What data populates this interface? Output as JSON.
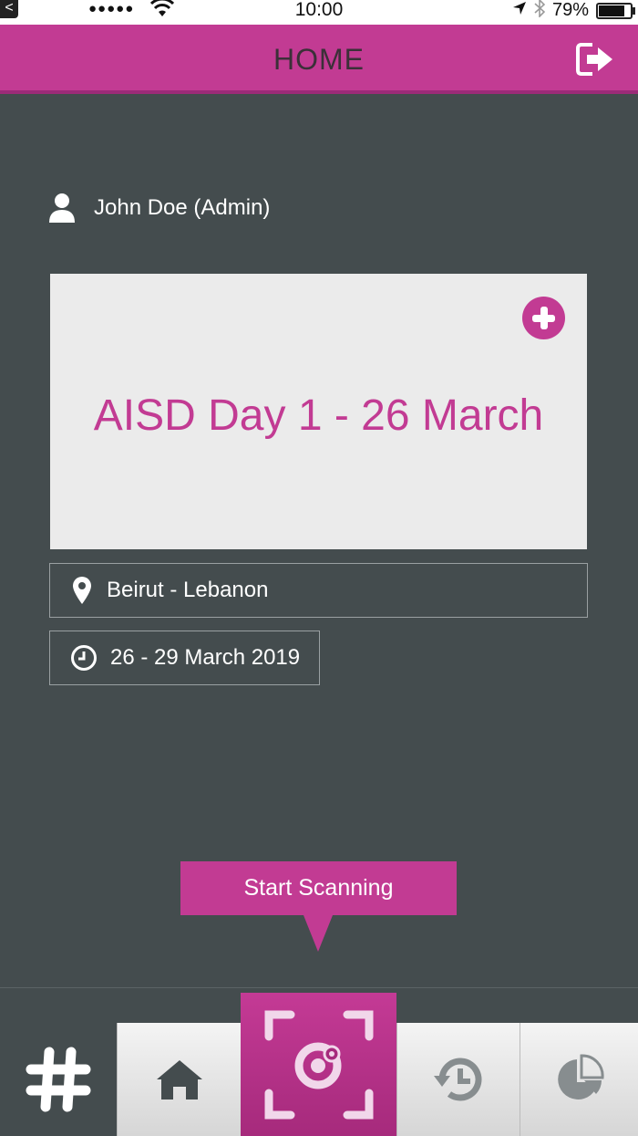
{
  "status_bar": {
    "back_glyph": "<",
    "signal": "●●●●●",
    "time": "10:00",
    "battery": "79%"
  },
  "header": {
    "title": "HOME",
    "logout_icon": "logout-icon"
  },
  "user": {
    "name": "John Doe (Admin)",
    "icon": "user-icon"
  },
  "event": {
    "title": "AISD Day 1 - 26 March",
    "add_icon": "plus-circle-icon"
  },
  "location": {
    "text": "Beirut - Lebanon",
    "icon": "map-pin-icon"
  },
  "date": {
    "text": "26 - 29 March 2019",
    "icon": "clock-icon"
  },
  "tooltip": {
    "text": "Start Scanning"
  },
  "tabs": [
    {
      "name": "tab-hashtag",
      "icon": "hashtag-icon"
    },
    {
      "name": "tab-home",
      "icon": "home-icon"
    },
    {
      "name": "tab-scan",
      "icon": "scan-camera-icon",
      "active": true
    },
    {
      "name": "tab-history",
      "icon": "history-icon"
    },
    {
      "name": "tab-stats",
      "icon": "pie-chart-icon"
    }
  ],
  "colors": {
    "accent": "#c23b93",
    "background": "#444c4e",
    "card": "#ebebeb"
  }
}
